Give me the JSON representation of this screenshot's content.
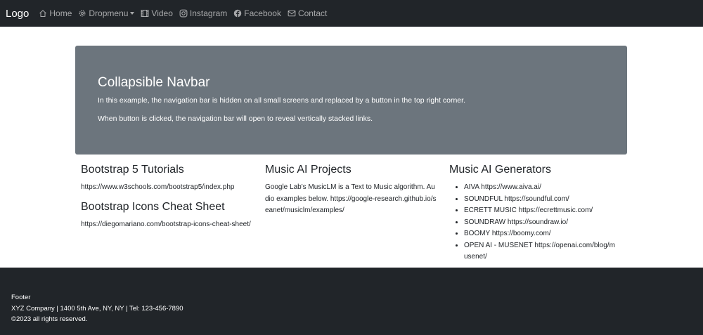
{
  "navbar": {
    "brand": "Logo",
    "items": [
      {
        "label": "Home",
        "icon": "house-icon"
      },
      {
        "label": "Dropmenu",
        "icon": "gear-icon"
      },
      {
        "label": "Video",
        "icon": "film-icon"
      },
      {
        "label": "Instagram",
        "icon": "instagram-icon"
      },
      {
        "label": "Facebook",
        "icon": "facebook-icon"
      },
      {
        "label": "Contact",
        "icon": "envelope-icon"
      }
    ]
  },
  "hero": {
    "title": "Collapsible Navbar",
    "line1": "In this example, the navigation bar is hidden on all small screens and replaced by a button in the top right corner.",
    "line2": "When button is clicked, the navigation bar will open to reveal vertically stacked links."
  },
  "col1": {
    "heading1": "Bootstrap 5 Tutorials",
    "link1": "https://www.w3schools.com/bootstrap5/index.php",
    "heading2": "Bootstrap Icons Cheat Sheet",
    "link2": "https://diegomariano.com/bootstrap-icons-cheat-sheet/"
  },
  "col2": {
    "heading": "Music AI Projects",
    "text": "Google Lab's MusicLM is a Text to Music algorithm. Audio examples below. https://google-research.github.io/seanet/musiclm/examples/"
  },
  "col3": {
    "heading": "Music AI Generators",
    "items": [
      "AIVA https://www.aiva.ai/",
      "SOUNDFUL https://soundful.com/",
      "ECRETT MUSIC https://ecrettmusic.com/",
      "SOUNDRAW https://soundraw.io/",
      "BOOMY https://boomy.com/",
      "OPEN AI - MUSENET https://openai.com/blog/musenet/"
    ]
  },
  "footer": {
    "title": "Footer",
    "address": "XYZ Company | 1400 5th Ave, NY, NY | Tel: 123-456-7890",
    "copyright": "©2023 all rights reserved."
  }
}
